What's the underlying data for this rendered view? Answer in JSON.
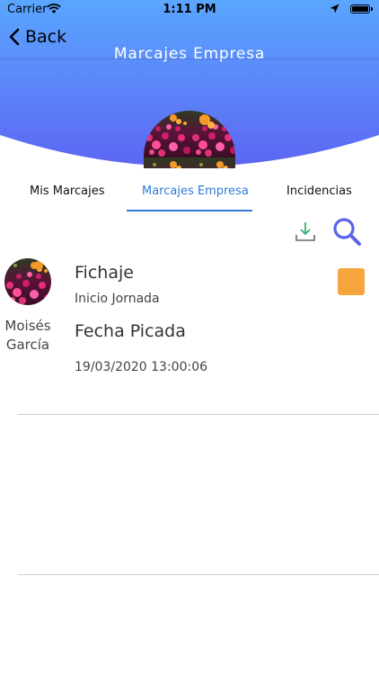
{
  "status_bar": {
    "carrier": "Carrier",
    "time": "1:11 PM"
  },
  "nav": {
    "back_label": "Back",
    "title": "Marcajes Empresa"
  },
  "colors": {
    "header_top": "#5aa6ff",
    "header_bottom": "#5c66f2",
    "accent": "#2e7bd6",
    "status": "#f6a53d",
    "download_icon": "#2fb36d",
    "search_icon": "#5b63e8"
  },
  "tabs": [
    {
      "label": "Mis Marcajes",
      "active": false
    },
    {
      "label": "Marcajes Empresa",
      "active": true
    },
    {
      "label": "Incidencias",
      "active": false
    }
  ],
  "toolbar": {
    "download_icon": "download-icon",
    "search_icon": "search-icon"
  },
  "record": {
    "user_first": "Moisés",
    "user_last": "García",
    "fichaje_title": "Fichaje",
    "fichaje_value": "Inicio Jornada",
    "fecha_title": "Fecha Picada",
    "fecha_value": "19/03/2020 13:00:06"
  }
}
